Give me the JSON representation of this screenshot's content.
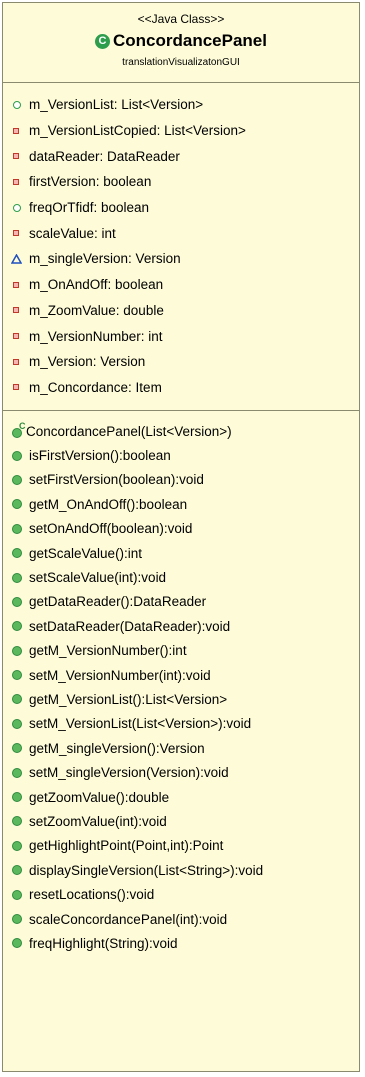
{
  "class_box": {
    "stereotype": "<<Java Class>>",
    "class_icon": "C",
    "name": "ConcordancePanel",
    "package": "translationVisualizatonGUI"
  },
  "attributes": [
    {
      "visibility": "public",
      "text": "m_VersionList: List<Version>"
    },
    {
      "visibility": "private",
      "text": "m_VersionListCopied: List<Version>"
    },
    {
      "visibility": "private",
      "text": "dataReader: DataReader"
    },
    {
      "visibility": "private",
      "text": "firstVersion: boolean"
    },
    {
      "visibility": "public",
      "text": "freqOrTfidf: boolean"
    },
    {
      "visibility": "private",
      "text": "scaleValue: int"
    },
    {
      "visibility": "package",
      "text": "m_singleVersion: Version"
    },
    {
      "visibility": "private",
      "text": "m_OnAndOff: boolean"
    },
    {
      "visibility": "private",
      "text": "m_ZoomValue: double"
    },
    {
      "visibility": "private",
      "text": "m_VersionNumber: int"
    },
    {
      "visibility": "private",
      "text": "m_Version: Version"
    },
    {
      "visibility": "private",
      "text": "m_Concordance: Item"
    }
  ],
  "methods": [
    {
      "kind": "constructor",
      "text": "ConcordancePanel(List<Version>)"
    },
    {
      "kind": "public",
      "text": "isFirstVersion():boolean"
    },
    {
      "kind": "public",
      "text": "setFirstVersion(boolean):void"
    },
    {
      "kind": "public",
      "text": "getM_OnAndOff():boolean"
    },
    {
      "kind": "public",
      "text": "setOnAndOff(boolean):void"
    },
    {
      "kind": "public",
      "text": "getScaleValue():int"
    },
    {
      "kind": "public",
      "text": "setScaleValue(int):void"
    },
    {
      "kind": "public",
      "text": "getDataReader():DataReader"
    },
    {
      "kind": "public",
      "text": "setDataReader(DataReader):void"
    },
    {
      "kind": "public",
      "text": "getM_VersionNumber():int"
    },
    {
      "kind": "public",
      "text": "setM_VersionNumber(int):void"
    },
    {
      "kind": "public",
      "text": "getM_VersionList():List<Version>"
    },
    {
      "kind": "public",
      "text": "setM_VersionList(List<Version>):void"
    },
    {
      "kind": "public",
      "text": "getM_singleVersion():Version"
    },
    {
      "kind": "public",
      "text": "setM_singleVersion(Version):void"
    },
    {
      "kind": "public",
      "text": "getZoomValue():double"
    },
    {
      "kind": "public",
      "text": "setZoomValue(int):void"
    },
    {
      "kind": "public",
      "text": "getHighlightPoint(Point,int):Point"
    },
    {
      "kind": "public",
      "text": "displaySingleVersion(List<String>):void"
    },
    {
      "kind": "public",
      "text": "resetLocations():void"
    },
    {
      "kind": "public",
      "text": "scaleConcordancePanel(int):void"
    },
    {
      "kind": "public",
      "text": "freqHighlight(String):void"
    }
  ],
  "colors": {
    "box_fill": "#fefcd8",
    "border": "#8a8a6e",
    "public_green": "#2e9e4c",
    "private_red": "#c0392b",
    "package_blue": "#1f4fbf"
  }
}
